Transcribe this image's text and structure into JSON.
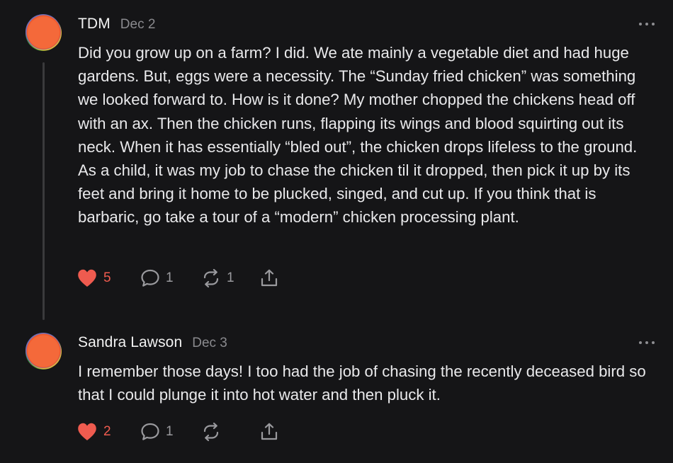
{
  "colors": {
    "background": "#151517",
    "text": "#e9e9eb",
    "muted": "#8a8a8e",
    "like": "#ef5b4f",
    "thread_line": "#3a3a3c"
  },
  "comments": [
    {
      "author": "TDM",
      "date": "Dec 2",
      "avatar_icon": "orange-circle-avatar",
      "text": "Did you grow up on a farm? I did. We ate mainly a vegetable diet and had huge gardens. But, eggs were a necessity. The “Sunday fried chicken” was something we looked forward to. How is it done? My mother chopped the chickens head off with an ax. Then the chicken runs, flapping its wings and blood squirting out its neck. When it has essentially “bled out”, the chicken drops lifeless to the ground. As a child, it was my job to chase the chicken til it dropped, then pick it up by its feet and bring it home to be plucked, singed, and cut up. If you think that is barbaric, go take a tour of a “modern” chicken processing plant.",
      "likes": "5",
      "replies": "1",
      "restacks": "1"
    },
    {
      "author": "Sandra Lawson",
      "date": "Dec 3",
      "avatar_icon": "orange-circle-avatar",
      "text": "I remember those days! I too had the job of chasing the recently deceased bird so that I could plunge it into hot water and then pluck it.",
      "likes": "2",
      "replies": "1",
      "restacks": ""
    }
  ]
}
